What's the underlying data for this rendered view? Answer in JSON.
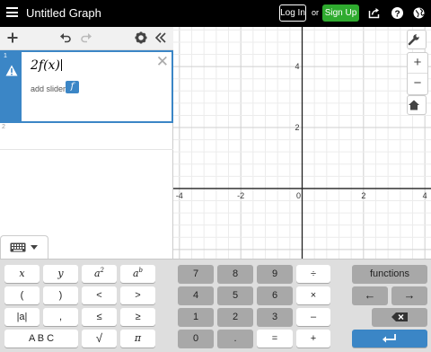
{
  "header": {
    "title": "Untitled Graph",
    "login_label": "Log In",
    "or_text": "or",
    "signup_label": "Sign Up",
    "icons": [
      "hamburger-menu-icon",
      "share-icon",
      "help-icon",
      "globe-icon"
    ]
  },
  "toolbar": {
    "icons": [
      "add-item-icon",
      "undo-icon",
      "redo-icon",
      "settings-icon",
      "collapse-panel-icon"
    ]
  },
  "expressions": [
    {
      "number": "1",
      "latex": "2f(x)",
      "status_icon": "warning-icon",
      "slider_label": "add slider:",
      "slider_button": "f"
    },
    {
      "number": "2",
      "latex": ""
    }
  ],
  "graph": {
    "x_ticks": [
      "-4",
      "-2",
      "0",
      "2",
      "4"
    ],
    "y_ticks": [
      "4",
      "2"
    ],
    "x_range": [
      -4.2,
      4.2
    ],
    "y_range": [
      -2.3,
      5.3
    ],
    "grid": true,
    "controls": [
      "wrench-icon",
      "zoom-in-icon",
      "zoom-out-icon",
      "home-icon"
    ]
  },
  "keypad": {
    "toggle_icon": "keyboard-icon",
    "row1": [
      "x",
      "y",
      "a",
      "b",
      "7",
      "8",
      "9",
      "÷",
      "functions"
    ],
    "row1_sup": [
      "",
      "",
      "2",
      "b"
    ],
    "row2": [
      "(",
      ")",
      "<",
      ">",
      "4",
      "5",
      "6",
      "×",
      "←",
      "→"
    ],
    "row3": [
      "|a|",
      ",",
      "≤",
      "≥",
      "1",
      "2",
      "3",
      "–"
    ],
    "row4": [
      "A B C",
      "√",
      "π",
      "0",
      ".",
      "=",
      "+"
    ],
    "backspace_icon": "backspace-icon",
    "enter_icon": "enter-icon"
  }
}
